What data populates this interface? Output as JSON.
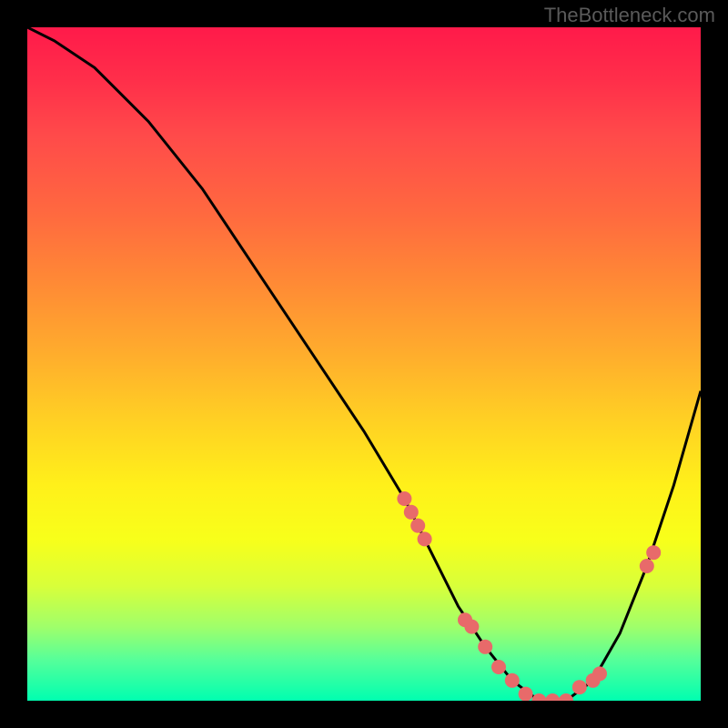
{
  "watermark": "TheBottleneck.com",
  "chart_data": {
    "type": "line",
    "title": "",
    "xlabel": "",
    "ylabel": "",
    "xlim": [
      0,
      100
    ],
    "ylim": [
      0,
      100
    ],
    "series": [
      {
        "name": "curve",
        "x": [
          0,
          4,
          10,
          18,
          26,
          34,
          42,
          50,
          56,
          60,
          64,
          68,
          72,
          76,
          80,
          84,
          88,
          92,
          96,
          100
        ],
        "values": [
          100,
          98,
          94,
          86,
          76,
          64,
          52,
          40,
          30,
          22,
          14,
          8,
          3,
          0,
          0,
          3,
          10,
          20,
          32,
          46
        ]
      }
    ],
    "scatter_points": {
      "name": "markers",
      "x": [
        56,
        57,
        58,
        59,
        65,
        66,
        68,
        70,
        72,
        74,
        76,
        78,
        80,
        82,
        84,
        85,
        92,
        93
      ],
      "values": [
        30,
        28,
        26,
        24,
        12,
        11,
        8,
        5,
        3,
        1,
        0,
        0,
        0,
        2,
        3,
        4,
        20,
        22
      ]
    },
    "gradient_stops": [
      {
        "pos": 0,
        "color": "#ff1a4a"
      },
      {
        "pos": 100,
        "color": "#00ffb0"
      }
    ]
  }
}
